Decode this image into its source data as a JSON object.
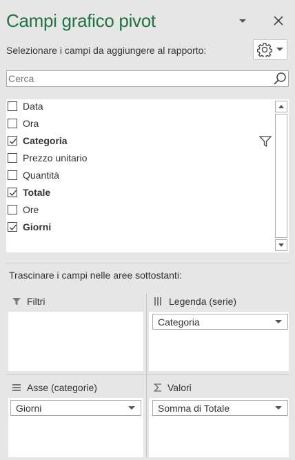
{
  "panel": {
    "title": "Campi grafico pivot",
    "subtitle": "Selezionare i campi da aggiungere al rapporto:"
  },
  "search": {
    "placeholder": "Cerca"
  },
  "fields": [
    {
      "label": "Data",
      "checked": false,
      "bold": false
    },
    {
      "label": "Ora",
      "checked": false,
      "bold": false
    },
    {
      "label": "Categoria",
      "checked": true,
      "bold": true,
      "filtered": true
    },
    {
      "label": "Prezzo unitario",
      "checked": false,
      "bold": false
    },
    {
      "label": "Quantità",
      "checked": false,
      "bold": false
    },
    {
      "label": "Totale",
      "checked": true,
      "bold": true
    },
    {
      "label": "Ore",
      "checked": false,
      "bold": false
    },
    {
      "label": "Giorni",
      "checked": true,
      "bold": true
    }
  ],
  "drag_hint": "Trascinare i campi nelle aree sottostanti:",
  "areas": {
    "filters": {
      "label": "Filtri",
      "items": []
    },
    "legend": {
      "label": "Legenda (serie)",
      "items": [
        "Categoria"
      ]
    },
    "axis": {
      "label": "Asse (categorie)",
      "items": [
        "Giorni"
      ]
    },
    "values": {
      "label": "Valori",
      "items": [
        "Somma di Totale"
      ]
    }
  },
  "colors": {
    "title": "#217346",
    "background": "#e6e6e6"
  }
}
